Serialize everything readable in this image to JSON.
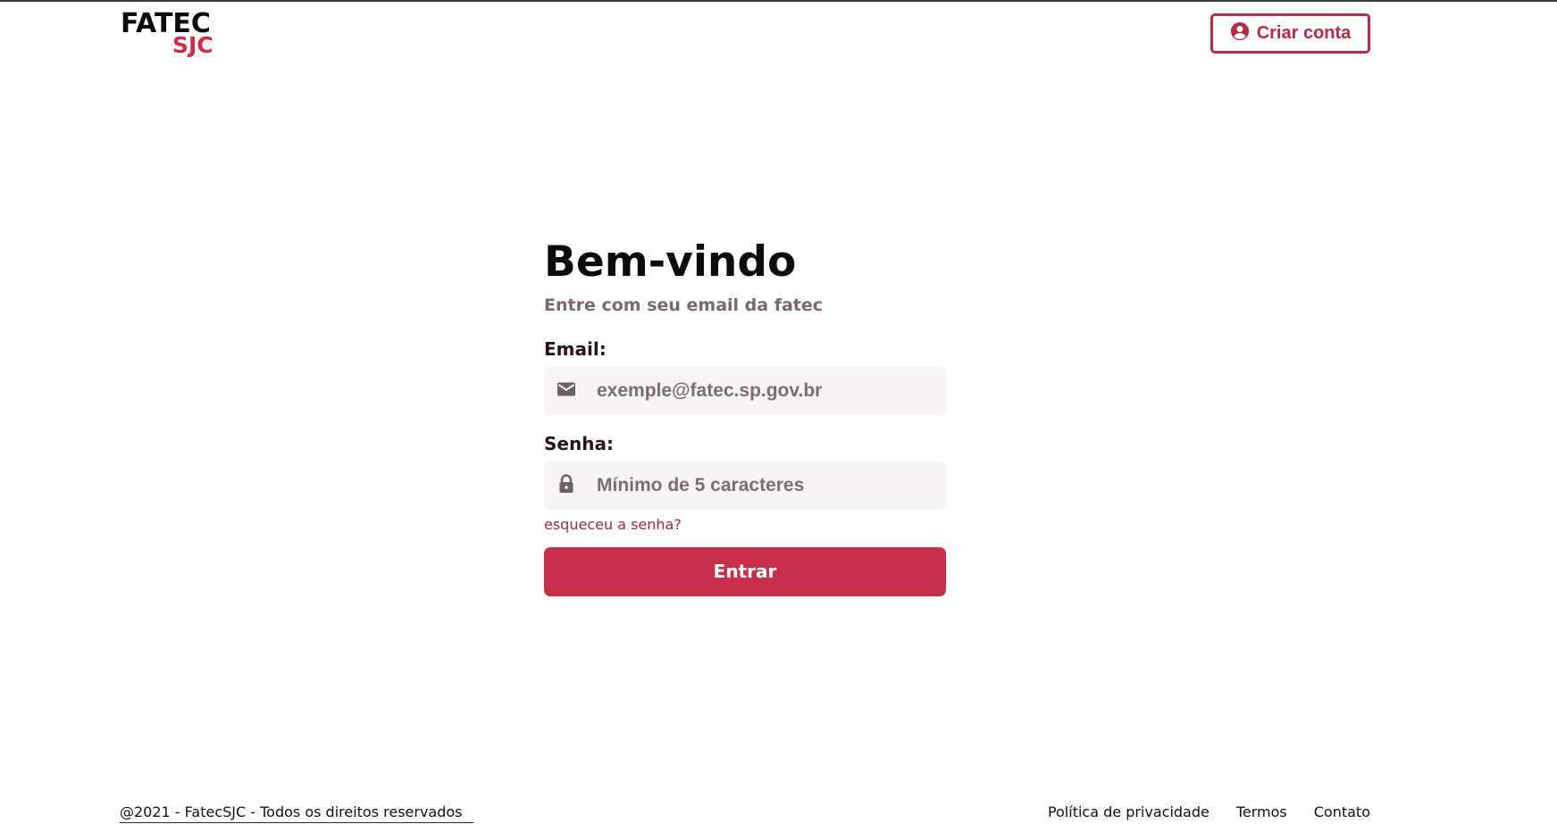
{
  "header": {
    "logo_top": "FATEC",
    "logo_bottom": "SJC",
    "create_account_label": "Criar conta",
    "create_account_icon": "user-circle-icon"
  },
  "login": {
    "title": "Bem-vindo",
    "subtitle": "Entre com seu email da fatec",
    "email_label": "Email:",
    "email_placeholder": "exemple@fatec.sp.gov.br",
    "email_icon": "mail-icon",
    "password_label": "Senha:",
    "password_placeholder": "Mínimo de 5 caracteres",
    "password_icon": "lock-icon",
    "forgot_label": "esqueceu a senha?",
    "submit_label": "Entrar"
  },
  "footer": {
    "copyright": "@2021 - FatecSJC - Todos os direitos reservados",
    "links": [
      "Política de privacidade",
      "Termos",
      "Contato"
    ]
  },
  "colors": {
    "brand": "#c8304a",
    "brand_dark": "#b22c48",
    "input_bg": "#f8f3f4",
    "muted_text": "#7a6770"
  }
}
